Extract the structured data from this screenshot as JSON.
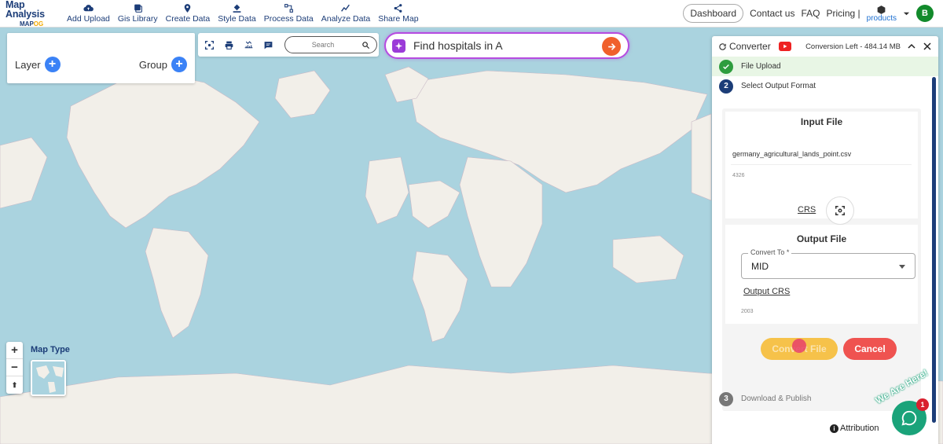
{
  "brand": {
    "title": "Map Analysis",
    "sub_prefix": "MAP",
    "sub_suffix": "OG"
  },
  "nav": {
    "items": [
      {
        "label": "Add Upload",
        "icon": "cloud-upload-icon"
      },
      {
        "label": "Gis Library",
        "icon": "library-icon"
      },
      {
        "label": "Create Data",
        "icon": "map-pin-icon"
      },
      {
        "label": "Style Data",
        "icon": "paint-bucket-icon"
      },
      {
        "label": "Process Data",
        "icon": "process-icon"
      },
      {
        "label": "Analyze Data",
        "icon": "analyze-icon"
      },
      {
        "label": "Share Map",
        "icon": "share-icon"
      }
    ],
    "dashboard": "Dashboard",
    "contact": "Contact us",
    "faq": "FAQ",
    "pricing": "Pricing |",
    "products": "products",
    "avatar": "B"
  },
  "layer_panel": {
    "layer": "Layer",
    "group": "Group"
  },
  "toolbar": {
    "search_placeholder": "Search"
  },
  "ai": {
    "prompt": "Find hospitals in A"
  },
  "converter": {
    "title": "Converter",
    "conversion_left": "Conversion Left - 484.14 MB",
    "step1": "File Upload",
    "step2_num": "2",
    "step2": "Select Output Format",
    "input_file_title": "Input File",
    "file_name": "germany_agricultural_lands_point.csv",
    "file_size": "4326",
    "crs": "CRS",
    "output_file_title": "Output File",
    "convert_to_label": "Convert To *",
    "convert_to_value": "MID",
    "output_crs": "Output CRS",
    "output_crs_value": "2003",
    "convert_btn": "Convert File",
    "cancel_btn": "Cancel",
    "step3_num": "3",
    "step3": "Download & Publish"
  },
  "map_controls": {
    "zoom_in": "+",
    "zoom_out": "−",
    "compass": "⬆",
    "map_type": "Map Type"
  },
  "attribution": "Attribution",
  "chat": {
    "badge": "1",
    "tag": "We Are Here!"
  },
  "colors": {
    "accent": "#1c3d78",
    "ocean": "#aad3df",
    "land": "#f2efe9",
    "convert": "#f6c24a",
    "cancel": "#ef5350"
  }
}
